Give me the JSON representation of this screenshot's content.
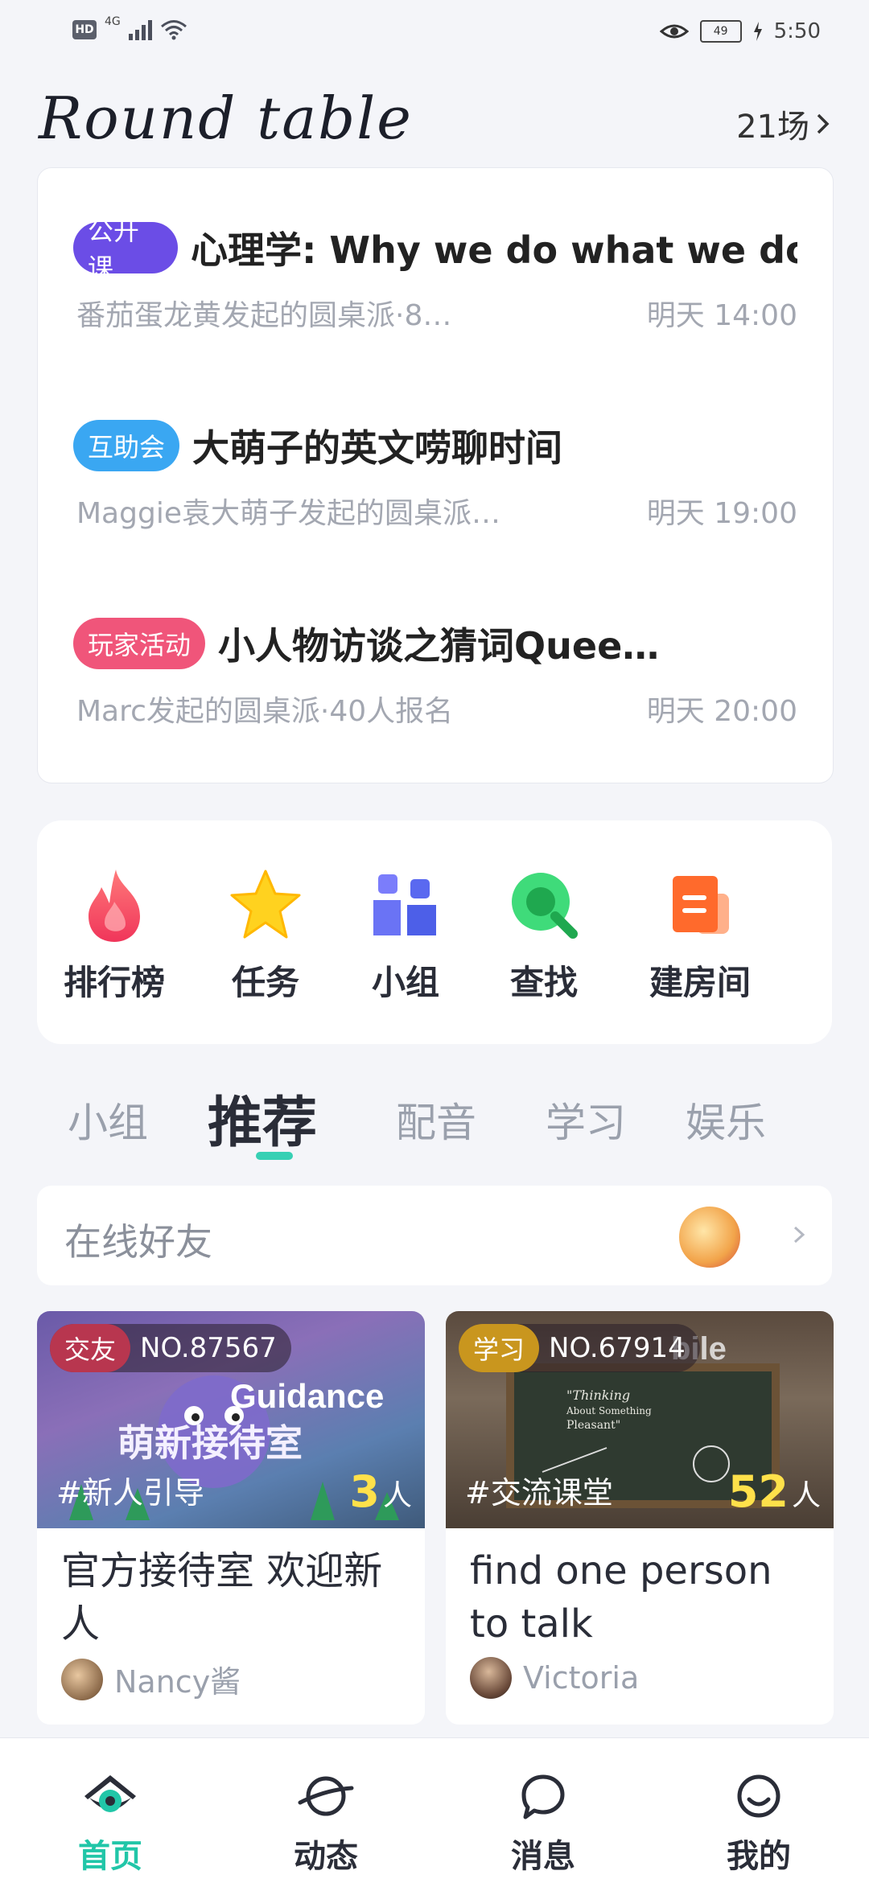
{
  "status_bar": {
    "hd": "HD",
    "network": "4G",
    "battery": "49",
    "time": "5:50"
  },
  "header": {
    "title": "Round table",
    "count": "21场"
  },
  "sessions": [
    {
      "tag": "公开课",
      "tag_color": "#6b4de6",
      "title": "心理学: Why we do what we do",
      "subtitle": "番茄蛋龙黄发起的圆桌派·8…",
      "time": "明天 14:00"
    },
    {
      "tag": "互助会",
      "tag_color": "#3aa7f2",
      "title": "大萌子的英文唠聊时间",
      "subtitle": "Maggie袁大萌子发起的圆桌派…",
      "time": "明天 19:00"
    },
    {
      "tag": "玩家活动",
      "tag_color": "#f0557a",
      "title": "小人物访谈之猜词Quee…",
      "subtitle": "Marc发起的圆桌派·40人报名",
      "time": "明天 20:00"
    }
  ],
  "shortcuts": [
    {
      "label": "排行榜",
      "icon": "flame-icon"
    },
    {
      "label": "任务",
      "icon": "star-icon"
    },
    {
      "label": "小组",
      "icon": "group-icon"
    },
    {
      "label": "查找",
      "icon": "search-icon"
    },
    {
      "label": "建房间",
      "icon": "document-icon"
    }
  ],
  "tabs": [
    "小组",
    "推荐",
    "配音",
    "学习",
    "娱乐"
  ],
  "active_tab": "推荐",
  "online_friends": {
    "label": "在线好友"
  },
  "rooms": [
    {
      "type": "交友",
      "type_color": "#b8364f",
      "number": "NO.87567",
      "hashtag": "#新人引导",
      "people_count": "3",
      "people_unit": "人",
      "title": "官方接待室 欢迎新人",
      "host": "Nancy酱"
    },
    {
      "type": "学习",
      "type_color": "#c9961e",
      "number": "NO.67914",
      "hashtag": "#交流课堂",
      "people_count": "52",
      "people_unit": "人",
      "title": "find one person to talk",
      "host": "Victoria"
    }
  ],
  "bottom_nav": [
    {
      "label": "首页",
      "icon": "home-icon"
    },
    {
      "label": "动态",
      "icon": "planet-icon"
    },
    {
      "label": "消息",
      "icon": "chat-bubble-icon"
    },
    {
      "label": "我的",
      "icon": "smiley-icon"
    }
  ],
  "colors": {
    "accent": "#21c6a8",
    "background": "#f4f5f9"
  }
}
